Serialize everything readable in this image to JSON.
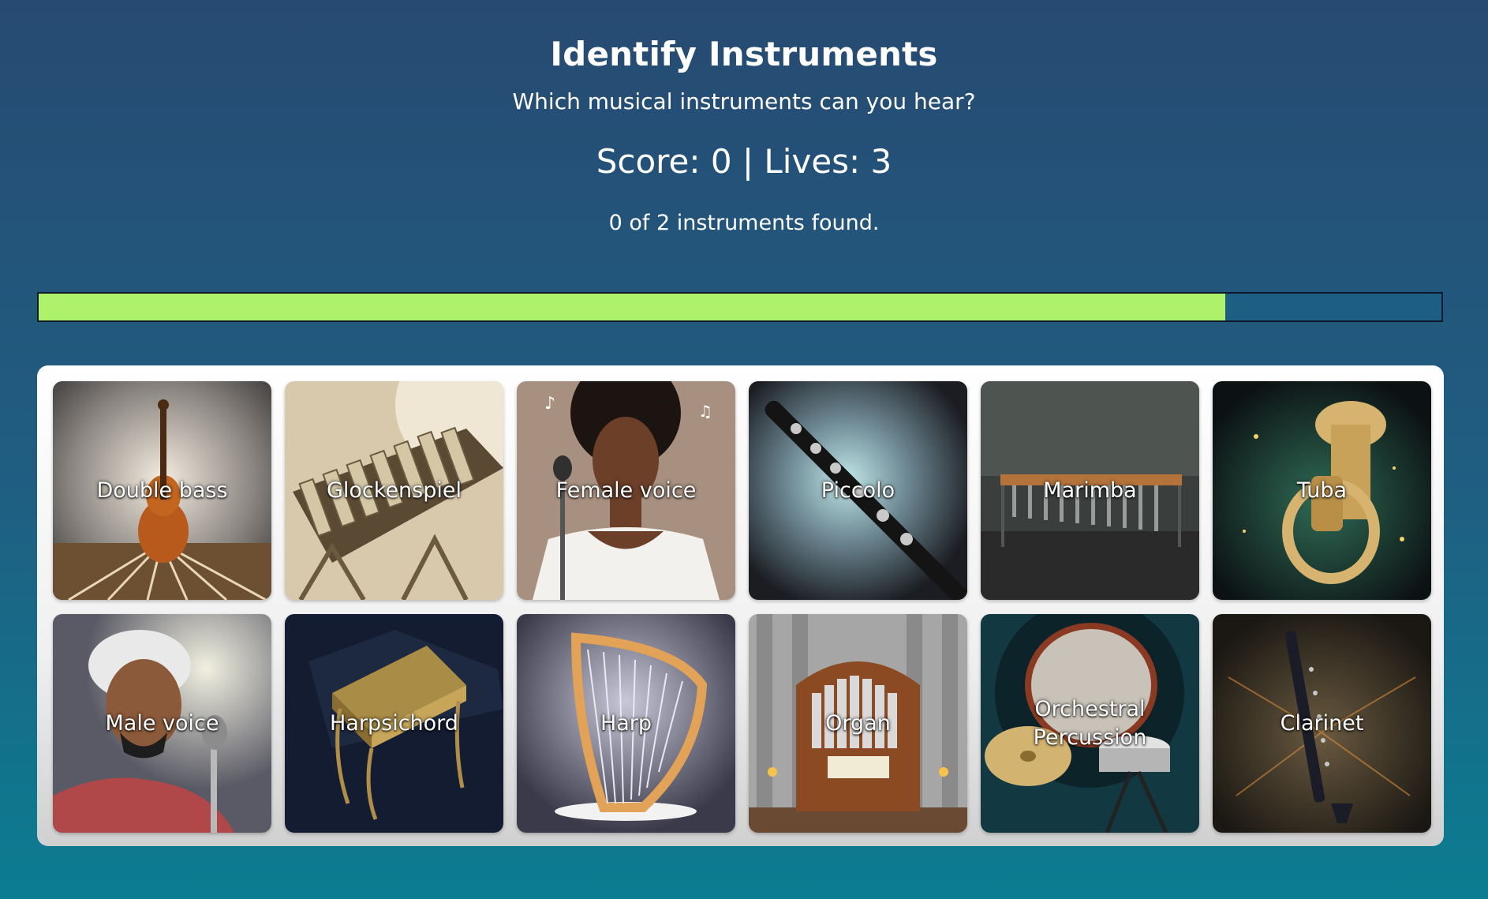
{
  "header": {
    "title": "Identify Instruments",
    "subtitle": "Which musical instruments can you hear?",
    "score_line": "Score: 0 | Lives: 3",
    "found_line": "0 of 2 instruments found."
  },
  "progress": {
    "fraction": 0.846,
    "fill_color": "#adf26a"
  },
  "instruments": [
    {
      "label": "Double bass",
      "icon": "double-bass-icon"
    },
    {
      "label": "Glockenspiel",
      "icon": "glockenspiel-icon"
    },
    {
      "label": "Female voice",
      "icon": "female-voice-icon"
    },
    {
      "label": "Piccolo",
      "icon": "piccolo-icon"
    },
    {
      "label": "Marimba",
      "icon": "marimba-icon"
    },
    {
      "label": "Tuba",
      "icon": "tuba-icon"
    },
    {
      "label": "Male voice",
      "icon": "male-voice-icon"
    },
    {
      "label": "Harpsichord",
      "icon": "harpsichord-icon"
    },
    {
      "label": "Harp",
      "icon": "harp-icon"
    },
    {
      "label": "Organ",
      "icon": "organ-icon"
    },
    {
      "label": "Orchestral Percussion",
      "icon": "orchestral-percussion-icon"
    },
    {
      "label": "Clarinet",
      "icon": "clarinet-icon"
    }
  ]
}
